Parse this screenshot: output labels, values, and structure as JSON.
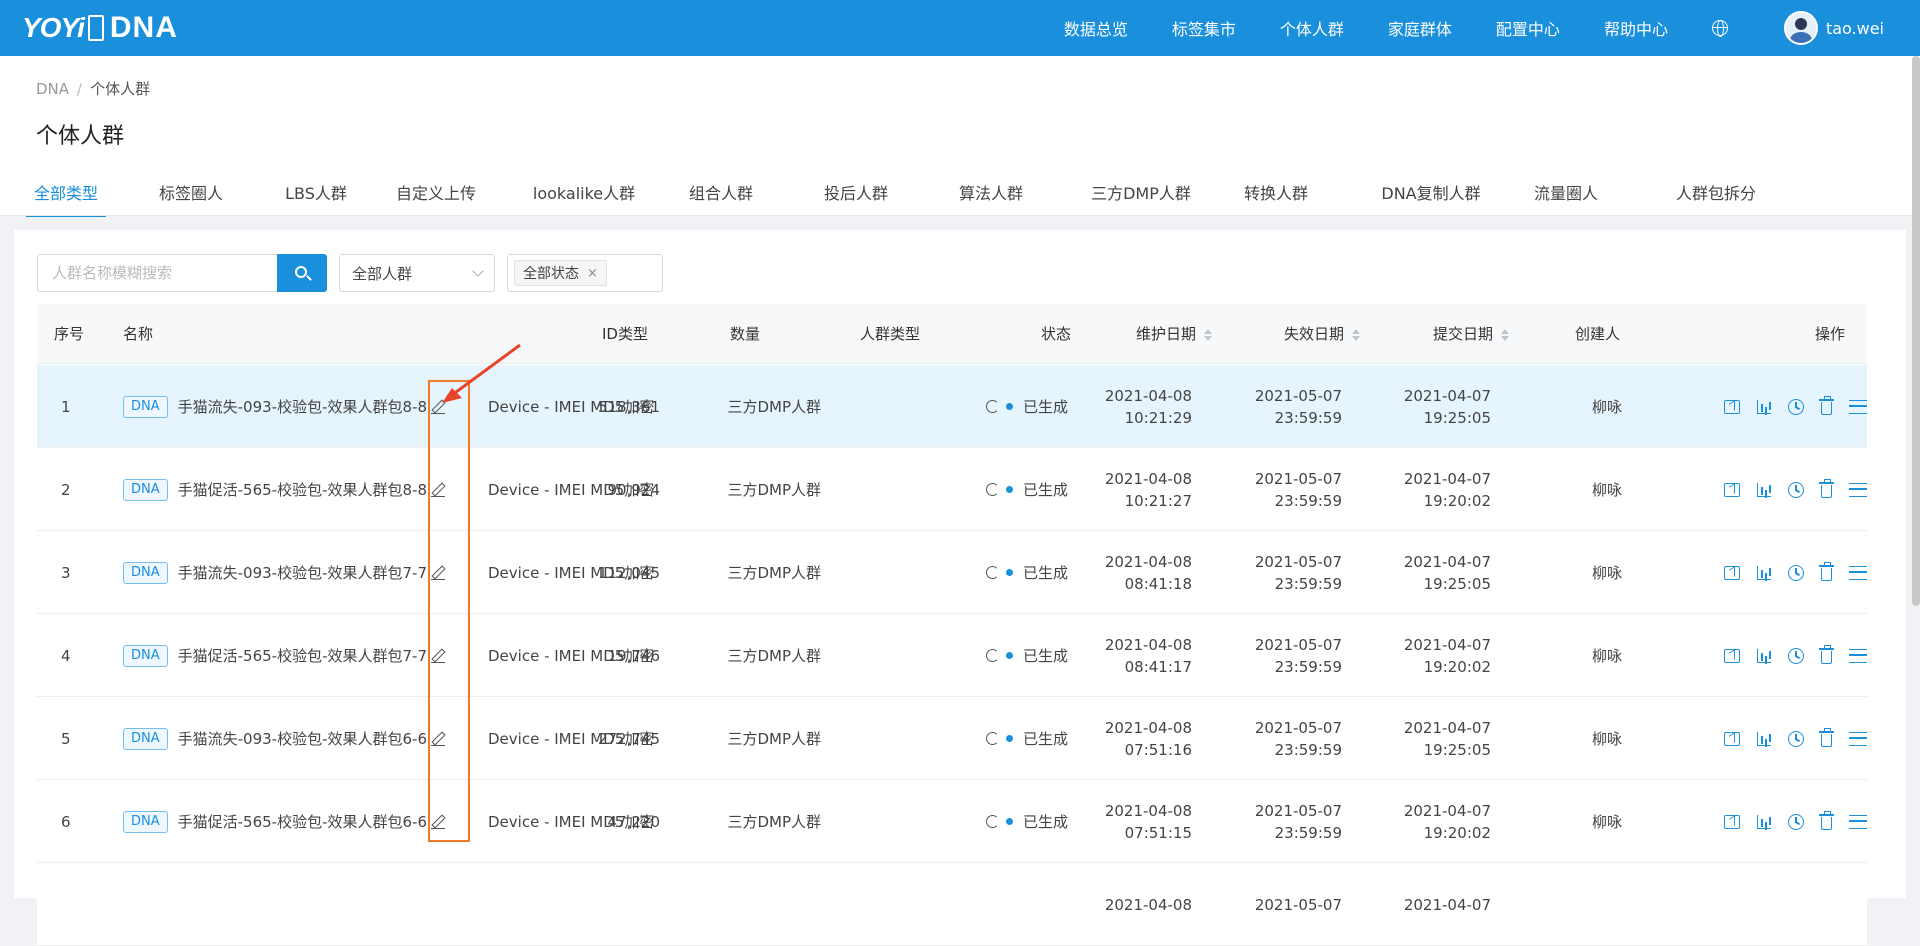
{
  "app": {
    "logo_text": "YOYi",
    "logo_badge": "悠易",
    "product": "DNA",
    "nav": [
      "数据总览",
      "标签集市",
      "个体人群",
      "家庭群体",
      "配置中心",
      "帮助中心"
    ],
    "user": "tao.wei"
  },
  "breadcrumb": {
    "root": "DNA",
    "current": "个体人群"
  },
  "page_title": "个体人群",
  "tabs": [
    "全部类型",
    "标签圈人",
    "LBS人群",
    "自定义上传",
    "lookalike人群",
    "组合人群",
    "投后人群",
    "算法人群",
    "三方DMP人群",
    "转换人群",
    "DNA复制人群",
    "流量圈人",
    "人群包拆分"
  ],
  "active_tab": "全部类型",
  "filters": {
    "search_placeholder": "人群名称模糊搜索",
    "audience_select": "全部人群",
    "status_tag": "全部状态"
  },
  "table": {
    "headers": {
      "index": "序号",
      "name": "名称",
      "id_type": "ID类型",
      "count": "数量",
      "audience_type": "人群类型",
      "status": "状态",
      "maintain_date": "维护日期",
      "expire_date": "失效日期",
      "submit_date": "提交日期",
      "creator": "创建人",
      "ops": "操作"
    },
    "tag_label": "DNA",
    "rows": [
      {
        "index": "1",
        "name": "手猫流失-093-校验包-效果人群包8-8",
        "id_type": "Device - IMEI MD5加密",
        "count": "518,361",
        "audience_type": "三方DMP人群",
        "status": "已生成",
        "maintain_date": "2021-04-08",
        "maintain_time": "10:21:29",
        "expire_date": "2021-05-07",
        "expire_time": "23:59:59",
        "submit_date": "2021-04-07",
        "submit_time": "19:25:05",
        "creator": "柳咏"
      },
      {
        "index": "2",
        "name": "手猫促活-565-校验包-效果人群包8-8",
        "id_type": "Device - IMEI MD5加密",
        "count": "90,924",
        "audience_type": "三方DMP人群",
        "status": "已生成",
        "maintain_date": "2021-04-08",
        "maintain_time": "10:21:27",
        "expire_date": "2021-05-07",
        "expire_time": "23:59:59",
        "submit_date": "2021-04-07",
        "submit_time": "19:20:02",
        "creator": "柳咏"
      },
      {
        "index": "3",
        "name": "手猫流失-093-校验包-效果人群包7-7",
        "id_type": "Device - IMEI MD5加密",
        "count": "112,045",
        "audience_type": "三方DMP人群",
        "status": "已生成",
        "maintain_date": "2021-04-08",
        "maintain_time": "08:41:18",
        "expire_date": "2021-05-07",
        "expire_time": "23:59:59",
        "submit_date": "2021-04-07",
        "submit_time": "19:25:05",
        "creator": "柳咏"
      },
      {
        "index": "4",
        "name": "手猫促活-565-校验包-效果人群包7-7",
        "id_type": "Device - IMEI MD5加密",
        "count": "19,746",
        "audience_type": "三方DMP人群",
        "status": "已生成",
        "maintain_date": "2021-04-08",
        "maintain_time": "08:41:17",
        "expire_date": "2021-05-07",
        "expire_time": "23:59:59",
        "submit_date": "2021-04-07",
        "submit_time": "19:20:02",
        "creator": "柳咏"
      },
      {
        "index": "5",
        "name": "手猫流失-093-校验包-效果人群包6-6",
        "id_type": "Device - IMEI MD5加密",
        "count": "272,745",
        "audience_type": "三方DMP人群",
        "status": "已生成",
        "maintain_date": "2021-04-08",
        "maintain_time": "07:51:16",
        "expire_date": "2021-05-07",
        "expire_time": "23:59:59",
        "submit_date": "2021-04-07",
        "submit_time": "19:25:05",
        "creator": "柳咏"
      },
      {
        "index": "6",
        "name": "手猫促活-565-校验包-效果人群包6-6",
        "id_type": "Device - IMEI MD5加密",
        "count": "47,220",
        "audience_type": "三方DMP人群",
        "status": "已生成",
        "maintain_date": "2021-04-08",
        "maintain_time": "07:51:15",
        "expire_date": "2021-05-07",
        "expire_time": "23:59:59",
        "submit_date": "2021-04-07",
        "submit_time": "19:20:02",
        "creator": "柳咏"
      },
      {
        "index": "",
        "name": "",
        "id_type": "",
        "count": "",
        "audience_type": "",
        "status": "",
        "maintain_date": "2021-04-08",
        "maintain_time": "",
        "expire_date": "2021-05-07",
        "expire_time": "",
        "submit_date": "2021-04-07",
        "submit_time": "",
        "creator": ""
      }
    ]
  },
  "colors": {
    "primary": "#1a8fdc",
    "highlight_row": "#e6f4fd",
    "annotation": "#ef7a2c"
  }
}
